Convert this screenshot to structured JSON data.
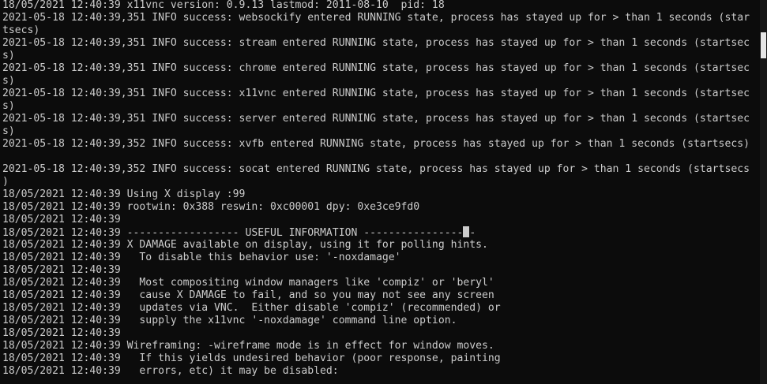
{
  "colors": {
    "background": "#0c0c0c",
    "foreground": "#cccccc",
    "scrollbar_track": "#171717",
    "scrollbar_thumb": "#e6e6e6"
  },
  "cursor_char": "-",
  "lines": [
    "18/05/2021 12:40:39 x11vnc version: 0.9.13 lastmod: 2011-08-10  pid: 18",
    "2021-05-18 12:40:39,351 INFO success: websockify entered RUNNING state, process has stayed up for > than 1 seconds (star",
    "tsecs)",
    "2021-05-18 12:40:39,351 INFO success: stream entered RUNNING state, process has stayed up for > than 1 seconds (startsec",
    "s)",
    "2021-05-18 12:40:39,351 INFO success: chrome entered RUNNING state, process has stayed up for > than 1 seconds (startsec",
    "s)",
    "2021-05-18 12:40:39,351 INFO success: x11vnc entered RUNNING state, process has stayed up for > than 1 seconds (startsec",
    "s)",
    "2021-05-18 12:40:39,351 INFO success: server entered RUNNING state, process has stayed up for > than 1 seconds (startsec",
    "s)",
    "2021-05-18 12:40:39,352 INFO success: xvfb entered RUNNING state, process has stayed up for > than 1 seconds (startsecs)",
    "",
    "2021-05-18 12:40:39,352 INFO success: socat entered RUNNING state, process has stayed up for > than 1 seconds (startsecs",
    ")",
    "18/05/2021 12:40:39 Using X display :99",
    "18/05/2021 12:40:39 rootwin: 0x388 reswin: 0xc00001 dpy: 0xe3ce9fd0",
    "18/05/2021 12:40:39",
    "18/05/2021 12:40:39 ------------------ USEFUL INFORMATION ----------------",
    "18/05/2021 12:40:39 X DAMAGE available on display, using it for polling hints.",
    "18/05/2021 12:40:39   To disable this behavior use: '-noxdamage'",
    "18/05/2021 12:40:39",
    "18/05/2021 12:40:39   Most compositing window managers like 'compiz' or 'beryl'",
    "18/05/2021 12:40:39   cause X DAMAGE to fail, and so you may not see any screen",
    "18/05/2021 12:40:39   updates via VNC.  Either disable 'compiz' (recommended) or",
    "18/05/2021 12:40:39   supply the x11vnc '-noxdamage' command line option.",
    "18/05/2021 12:40:39",
    "18/05/2021 12:40:39 Wireframing: -wireframe mode is in effect for window moves.",
    "18/05/2021 12:40:39   If this yields undesired behavior (poor response, painting",
    "18/05/2021 12:40:39   errors, etc) it may be disabled:"
  ]
}
